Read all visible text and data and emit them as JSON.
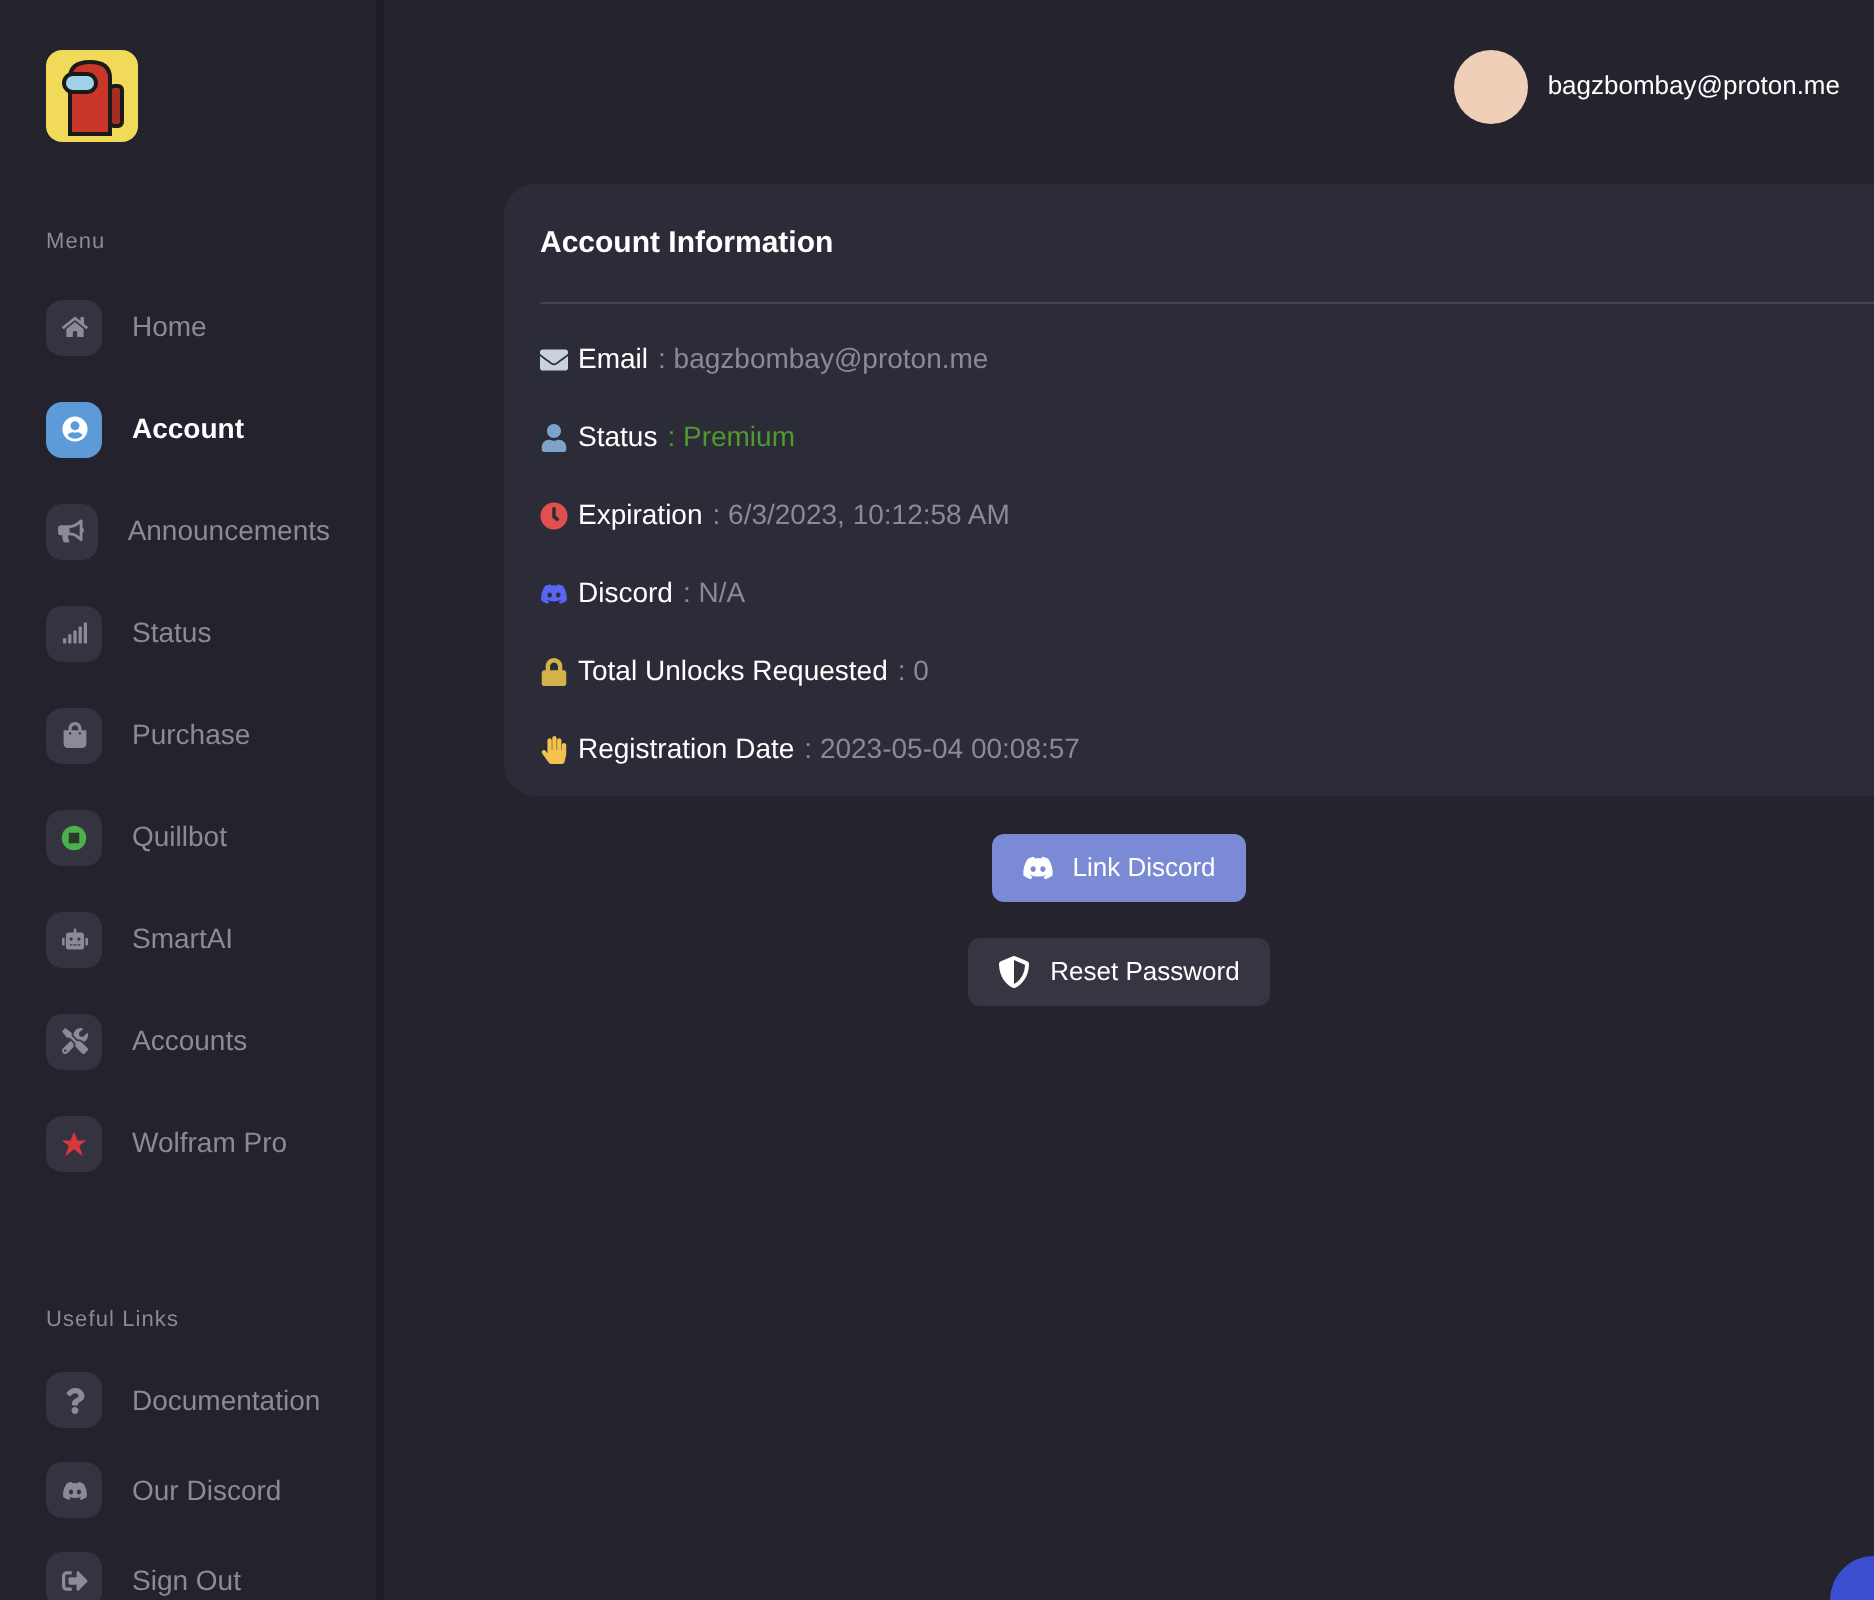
{
  "user": {
    "email": "bagzbombay@proton.me"
  },
  "sidebar": {
    "menu_label": "Menu",
    "items": [
      {
        "label": "Home",
        "selected": false
      },
      {
        "label": "Account",
        "selected": true
      },
      {
        "label": "Announcements",
        "selected": false
      },
      {
        "label": "Status",
        "selected": false
      },
      {
        "label": "Purchase",
        "selected": false
      },
      {
        "label": "Quillbot",
        "selected": false
      },
      {
        "label": "SmartAI",
        "selected": false
      },
      {
        "label": "Accounts",
        "selected": false
      },
      {
        "label": "Wolfram Pro",
        "selected": false
      }
    ],
    "links_label": "Useful Links",
    "links": [
      {
        "label": "Documentation"
      },
      {
        "label": "Our Discord"
      },
      {
        "label": "Sign Out"
      }
    ]
  },
  "card": {
    "title": "Account Information",
    "rows": [
      {
        "label": "Email",
        "value": ": bagzbombay@proton.me",
        "color": "#8a8a96"
      },
      {
        "label": "Status",
        "value": ": Premium",
        "color": "#4e9a2e"
      },
      {
        "label": "Expiration",
        "value": ": 6/3/2023, 10:12:58 AM",
        "color": "#8a8a96"
      },
      {
        "label": "Discord",
        "value": ": N/A",
        "color": "#8a8a96"
      },
      {
        "label": "Total Unlocks Requested",
        "value": ": 0",
        "color": "#8a8a96"
      },
      {
        "label": "Registration Date",
        "value": ": 2023-05-04 00:08:57",
        "color": "#8a8a96"
      }
    ]
  },
  "buttons": [
    {
      "label": "Link Discord",
      "kind": "discord"
    },
    {
      "label": "Reset Password",
      "kind": "reset"
    }
  ]
}
